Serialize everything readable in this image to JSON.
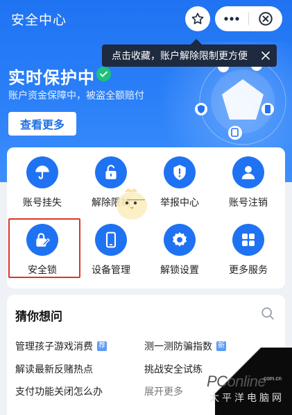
{
  "header": {
    "title": "安全中心",
    "star_icon": "star-icon",
    "more_icon": "more-dots-icon",
    "close_icon": "close-circle-icon"
  },
  "tooltip": {
    "text": "点击收藏，账户解除限制更方便"
  },
  "hero": {
    "title": "实时保护中",
    "subtitle": "账户资金保障中，被盗全额赔付",
    "button_label": "查看更多"
  },
  "services": [
    {
      "label": "账号挂失",
      "icon": "umbrella-icon"
    },
    {
      "label": "解除限制",
      "icon": "unlock-icon"
    },
    {
      "label": "举报中心",
      "icon": "alert-shield-icon"
    },
    {
      "label": "账号注销",
      "icon": "user-icon"
    },
    {
      "label": "安全锁",
      "icon": "lock-pen-icon"
    },
    {
      "label": "设备管理",
      "icon": "phone-icon"
    },
    {
      "label": "解锁设置",
      "icon": "gear-icon"
    },
    {
      "label": "更多服务",
      "icon": "apps-icon"
    }
  ],
  "questions": {
    "title": "猜你想问",
    "items": [
      {
        "text": "管理孩子游戏消费",
        "badge": "荐"
      },
      {
        "text": "测一测防骗指数",
        "badge": "新"
      },
      {
        "text": "解读最新反赌热点"
      },
      {
        "text": "挑战安全试练"
      },
      {
        "text": "支付功能关闭怎么办"
      },
      {
        "text": "展开更多"
      }
    ]
  },
  "watermark": {
    "name_main": "PConline",
    "url": ".com.cn",
    "tagline": "太平洋电脑网"
  },
  "colors": {
    "primary": "#1f73f2",
    "highlight_border": "#d9362b",
    "check_green": "#1dc27a"
  }
}
